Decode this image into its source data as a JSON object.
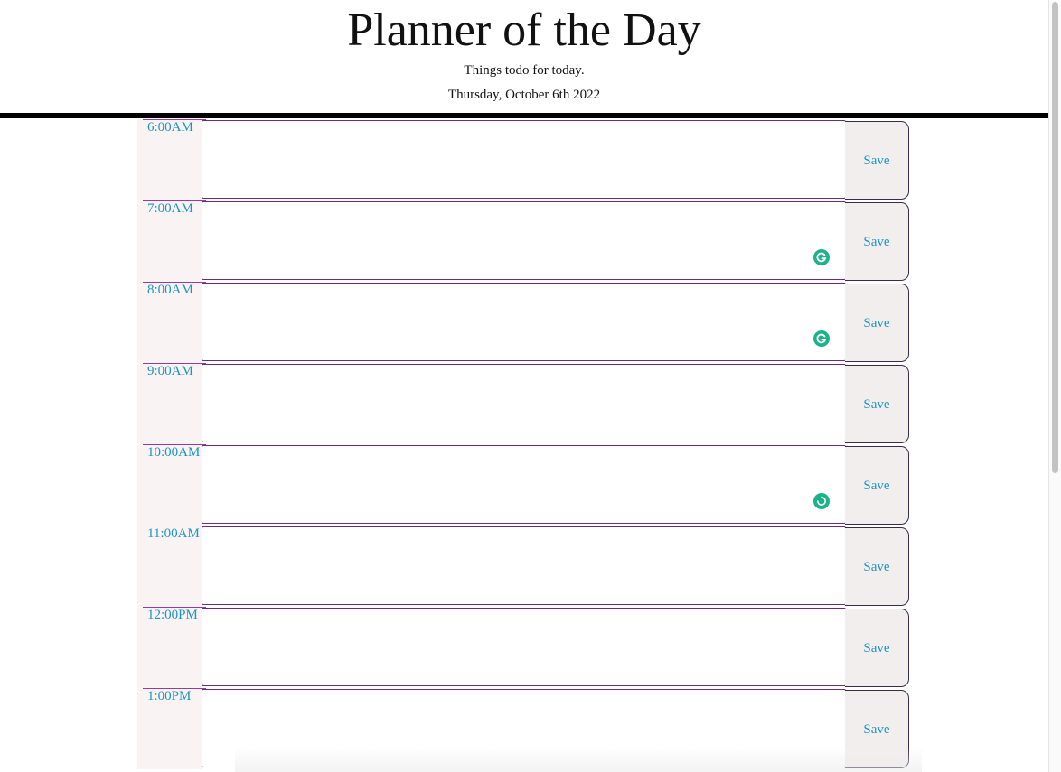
{
  "header": {
    "title": "Planner of the Day",
    "subtitle": "Things todo for today.",
    "date": "Thursday, October 6th 2022"
  },
  "rows": [
    {
      "hour": "6:00AM",
      "save_label": "Save",
      "text": "",
      "grammarly_badge": false
    },
    {
      "hour": "7:00AM",
      "save_label": "Save",
      "text": "",
      "grammarly_badge": true
    },
    {
      "hour": "8:00AM",
      "save_label": "Save",
      "text": "",
      "grammarly_badge": true
    },
    {
      "hour": "9:00AM",
      "save_label": "Save",
      "text": "",
      "grammarly_badge": false
    },
    {
      "hour": "10:00AM",
      "save_label": "Save",
      "text": "",
      "grammarly_badge": true
    },
    {
      "hour": "11:00AM",
      "save_label": "Save",
      "text": "",
      "grammarly_badge": false
    },
    {
      "hour": "12:00PM",
      "save_label": "Save",
      "text": "",
      "grammarly_badge": false
    },
    {
      "hour": "1:00PM",
      "save_label": "Save",
      "text": "",
      "grammarly_badge": false
    }
  ],
  "colors": {
    "hour_text": "#1a96be",
    "save_text": "#1a96be",
    "row_border": "#6a2a80",
    "save_bg": "#f3eeee",
    "hour_bg": "#f9f3f4",
    "grammarly_badge": "#1db289",
    "divider": "#000000"
  },
  "icons": {
    "grammarly": "grammarly-g-icon",
    "resize": "resize-grip-icon"
  }
}
